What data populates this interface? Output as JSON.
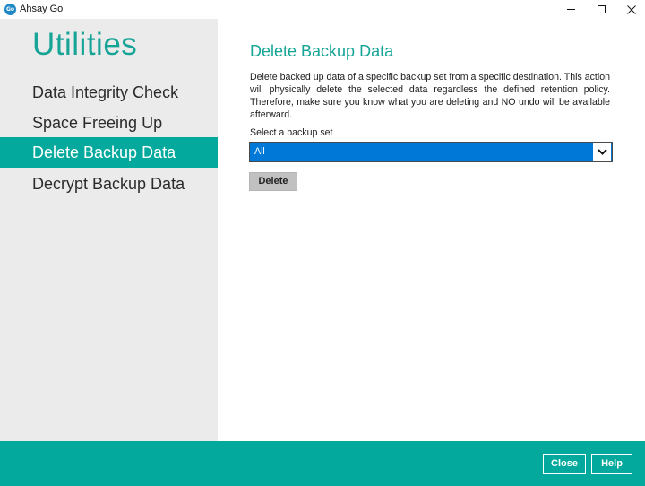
{
  "window": {
    "title": "Ahsay Go",
    "logo_text": "Go"
  },
  "sidebar": {
    "title": "Utilities",
    "items": [
      {
        "label": "Data Integrity Check",
        "active": false
      },
      {
        "label": "Space Freeing Up",
        "active": false
      },
      {
        "label": "Delete Backup Data",
        "active": true
      },
      {
        "label": "Decrypt Backup Data",
        "active": false
      }
    ]
  },
  "main": {
    "title": "Delete Backup Data",
    "description": "Delete backed up data of a specific backup set from a specific destination. This action will physically delete the selected data regardless the defined retention policy. Therefore, make sure you know what you are deleting and NO undo will be available afterward.",
    "select_label": "Select a backup set",
    "select_value": "All",
    "delete_label": "Delete"
  },
  "footer": {
    "close_label": "Close",
    "help_label": "Help"
  },
  "colors": {
    "accent": "#02a99c",
    "select_highlight": "#0078d7",
    "sidebar_bg": "#ebebeb"
  },
  "icons": {
    "logo": "ahsay-go-logo-icon",
    "minimize": "minimize-icon",
    "maximize": "maximize-icon",
    "close": "close-icon",
    "dropdown": "chevron-down-icon"
  }
}
